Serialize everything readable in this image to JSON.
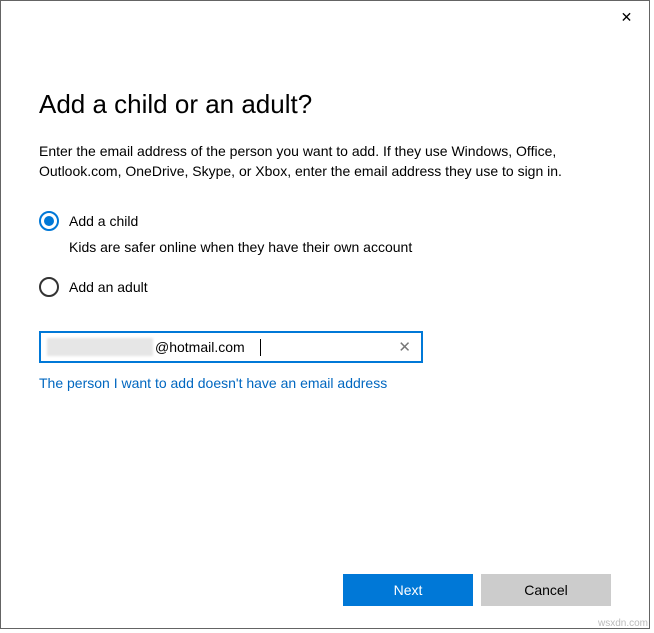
{
  "heading": "Add a child or an adult?",
  "description": "Enter the email address of the person you want to add. If they use Windows, Office, Outlook.com, OneDrive, Skype, or Xbox, enter the email address they use to sign in.",
  "radios": {
    "child": {
      "label": "Add a child",
      "hint": "Kids are safer online when they have their own account",
      "selected": true
    },
    "adult": {
      "label": "Add an adult",
      "selected": false
    }
  },
  "email": {
    "suffix": "@hotmail.com"
  },
  "link_no_email": "The person I want to add doesn't have an email address",
  "buttons": {
    "next": "Next",
    "cancel": "Cancel"
  },
  "watermark": "wsxdn.com",
  "colors": {
    "accent": "#0078d7",
    "link": "#0067c0",
    "btn_secondary_bg": "#cccccc"
  }
}
